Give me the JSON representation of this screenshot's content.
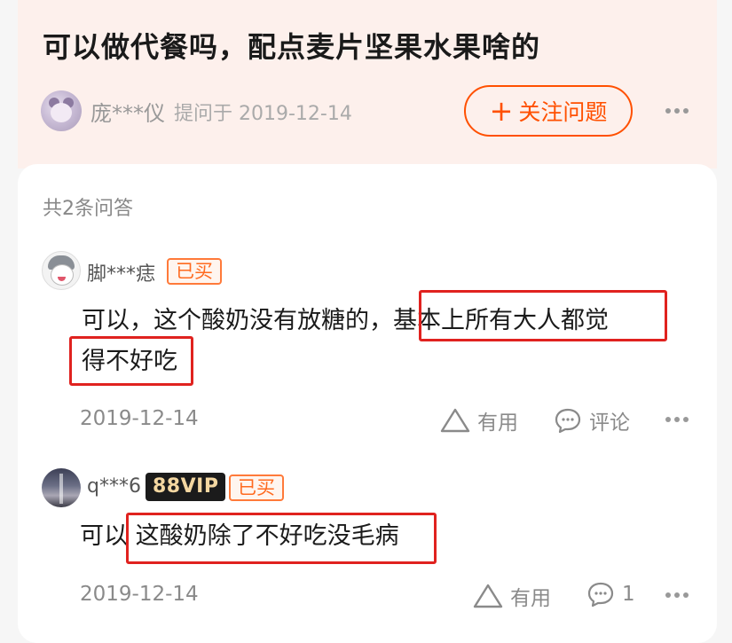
{
  "question": {
    "title": "可以做代餐吗，配点麦片坚果水果啥的",
    "asker_name": "庞***仪",
    "asker_meta": "提问于 2019-12-14",
    "follow_label": "关注问题",
    "follow_icon": "+"
  },
  "answers_section": {
    "total_label": "共2条问答"
  },
  "answers": [
    {
      "user": "脚***痣",
      "badges": [
        "已买"
      ],
      "text_line1": "可以，这个酸奶没有放糖的，基本上所有大人都觉",
      "text_line2": "得不好吃",
      "date": "2019-12-14",
      "useful_label": "有用",
      "comment_label": "评论"
    },
    {
      "user": "q***6",
      "badges": [
        "88VIP",
        "已买"
      ],
      "text_line1": "可以 这酸奶除了不好吃没毛病",
      "date": "2019-12-14",
      "useful_label": "有用",
      "comment_count": "1"
    }
  ],
  "colors": {
    "accent": "#ff5000",
    "highlight_box": "#e0221f",
    "header_bg": "#fdf0ec"
  },
  "icons": [
    "plus-icon",
    "more-icon",
    "thumb-up-icon",
    "comment-icon"
  ]
}
